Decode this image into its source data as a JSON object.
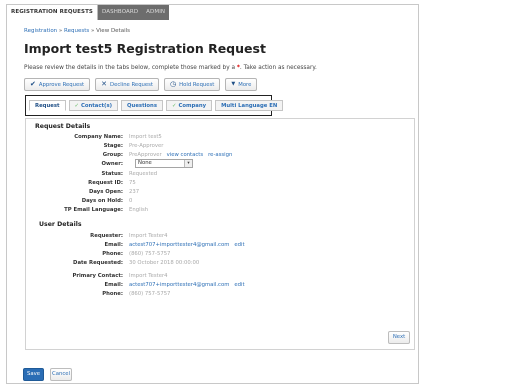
{
  "topnav": [
    {
      "label": "REGISTRATION REQUESTS",
      "active": true
    },
    {
      "label": "DASHBOARD",
      "active": false
    },
    {
      "label": "ADMIN",
      "active": false
    }
  ],
  "breadcrumb": {
    "item1": "Registration",
    "sep1": " » ",
    "item2": "Requests",
    "sep2": " » ",
    "item3": "View Details"
  },
  "page_title": "Import test5 Registration Request",
  "description": {
    "before": "Please review the details in the tabs below, complete those marked by a ",
    "marker": "*",
    "after": ". Take action as necessary."
  },
  "actions": [
    {
      "name": "approve-request-button",
      "icon": "checkmark-icon",
      "glyph": "✔",
      "label": "Approve Request"
    },
    {
      "name": "decline-request-button",
      "icon": "x-icon",
      "glyph": "✕",
      "label": "Decline Request"
    },
    {
      "name": "hold-request-button",
      "icon": "clock-icon",
      "glyph": "◷",
      "label": "Hold Request"
    },
    {
      "name": "more-button",
      "icon": "caret-down-icon",
      "glyph": "▼",
      "label": "More"
    }
  ],
  "tabs": [
    {
      "label": "Request",
      "checked": false,
      "active": true
    },
    {
      "label": "Contact(s)",
      "checked": true,
      "active": false
    },
    {
      "label": "Questions",
      "checked": false,
      "active": false
    },
    {
      "label": "Company",
      "checked": true,
      "active": false
    },
    {
      "label": "Multi Language EN",
      "checked": false,
      "active": false
    }
  ],
  "request_details": {
    "heading": "Request Details",
    "company_name": {
      "label": "Company Name:",
      "value": "Import test5"
    },
    "stage": {
      "label": "Stage:",
      "value": "Pre-Approver"
    },
    "group": {
      "label": "Group:",
      "value": "PreApprover",
      "link1": "view contacts",
      "link2": "re-assign"
    },
    "owner": {
      "label": "Owner:",
      "value": "None"
    },
    "status": {
      "label": "Status:",
      "value": "Requested"
    },
    "request_id": {
      "label": "Request ID:",
      "value": "75"
    },
    "days_open": {
      "label": "Days Open:",
      "value": "237"
    },
    "days_on_hold": {
      "label": "Days on Hold:",
      "value": "0"
    },
    "tp_email_language": {
      "label": "TP Email Language:",
      "value": "English"
    }
  },
  "user_details": {
    "heading": "User Details",
    "requester": {
      "label": "Requester:",
      "value": "Import Tester4"
    },
    "email": {
      "label": "Email:",
      "value": "actest707+importtester4@gmail.com",
      "edit": "edit"
    },
    "phone": {
      "label": "Phone:",
      "value": "(860) 757-5757"
    },
    "date_requested": {
      "label": "Date Requested:",
      "value": "30 October 2018 00:00:00"
    },
    "primary_contact": {
      "label": "Primary Contact:",
      "value": "Import Tester4"
    },
    "primary_email": {
      "label": "Email:",
      "value": "actest707+importtester4@gmail.com",
      "edit": "edit"
    },
    "primary_phone": {
      "label": "Phone:",
      "value": "(860) 757-5757"
    }
  },
  "next_label": "Next",
  "save_label": "Save",
  "cancel_label": "Cancel",
  "colors": {
    "link": "#2a6db5",
    "nav_bg": "#6d6d6d",
    "required": "#dd0000",
    "check": "#5cb85c"
  }
}
